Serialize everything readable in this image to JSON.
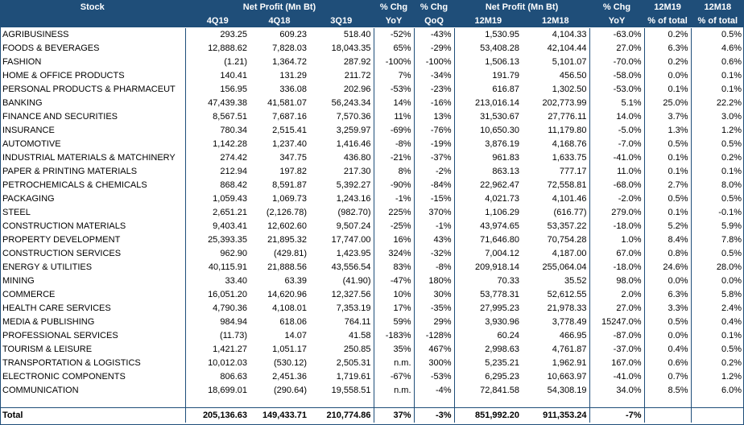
{
  "header": {
    "stock": "Stock",
    "net_profit_q": "Net Profit (Mn Bt)",
    "pct_chg_yoy_top": "% Chg",
    "pct_chg_qoq_top": "% Chg",
    "net_profit_12m": "Net Profit (Mn Bt)",
    "pct_chg_12m_top": "% Chg",
    "m19_top": "12M19",
    "m18_top": "12M18",
    "q4_19": "4Q19",
    "q4_18": "4Q18",
    "q3_19": "3Q19",
    "yoy": "YoY",
    "qoq": "QoQ",
    "m12_19": "12M19",
    "m12_18": "12M18",
    "yoy2": "YoY",
    "pct_total_19": "% of total",
    "pct_total_18": "% of total"
  },
  "rows": [
    {
      "name": "AGRIBUSINESS",
      "q4_19": "293.25",
      "q4_18": "609.23",
      "q3_19": "518.40",
      "yoy": "-52%",
      "qoq": "-43%",
      "m12_19": "1,530.95",
      "m12_18": "4,104.33",
      "chg12": "-63.0%",
      "pt19": "0.2%",
      "pt18": "0.5%"
    },
    {
      "name": "FOODS & BEVERAGES",
      "q4_19": "12,888.62",
      "q4_18": "7,828.03",
      "q3_19": "18,043.35",
      "yoy": "65%",
      "qoq": "-29%",
      "m12_19": "53,408.28",
      "m12_18": "42,104.44",
      "chg12": "27.0%",
      "pt19": "6.3%",
      "pt18": "4.6%"
    },
    {
      "name": "FASHION",
      "q4_19": "(1.21)",
      "q4_18": "1,364.72",
      "q3_19": "287.92",
      "yoy": "-100%",
      "qoq": "-100%",
      "m12_19": "1,506.13",
      "m12_18": "5,101.07",
      "chg12": "-70.0%",
      "pt19": "0.2%",
      "pt18": "0.6%"
    },
    {
      "name": "HOME & OFFICE PRODUCTS",
      "q4_19": "140.41",
      "q4_18": "131.29",
      "q3_19": "211.72",
      "yoy": "7%",
      "qoq": "-34%",
      "m12_19": "191.79",
      "m12_18": "456.50",
      "chg12": "-58.0%",
      "pt19": "0.0%",
      "pt18": "0.1%"
    },
    {
      "name": "PERSONAL PRODUCTS & PHARMACEUT",
      "q4_19": "156.95",
      "q4_18": "336.08",
      "q3_19": "202.96",
      "yoy": "-53%",
      "qoq": "-23%",
      "m12_19": "616.87",
      "m12_18": "1,302.50",
      "chg12": "-53.0%",
      "pt19": "0.1%",
      "pt18": "0.1%"
    },
    {
      "name": "BANKING",
      "q4_19": "47,439.38",
      "q4_18": "41,581.07",
      "q3_19": "56,243.34",
      "yoy": "14%",
      "qoq": "-16%",
      "m12_19": "213,016.14",
      "m12_18": "202,773.99",
      "chg12": "5.1%",
      "pt19": "25.0%",
      "pt18": "22.2%"
    },
    {
      "name": "FINANCE AND SECURITIES",
      "q4_19": "8,567.51",
      "q4_18": "7,687.16",
      "q3_19": "7,570.36",
      "yoy": "11%",
      "qoq": "13%",
      "m12_19": "31,530.67",
      "m12_18": "27,776.11",
      "chg12": "14.0%",
      "pt19": "3.7%",
      "pt18": "3.0%"
    },
    {
      "name": "INSURANCE",
      "q4_19": "780.34",
      "q4_18": "2,515.41",
      "q3_19": "3,259.97",
      "yoy": "-69%",
      "qoq": "-76%",
      "m12_19": "10,650.30",
      "m12_18": "11,179.80",
      "chg12": "-5.0%",
      "pt19": "1.3%",
      "pt18": "1.2%"
    },
    {
      "name": "AUTOMOTIVE",
      "q4_19": "1,142.28",
      "q4_18": "1,237.40",
      "q3_19": "1,416.46",
      "yoy": "-8%",
      "qoq": "-19%",
      "m12_19": "3,876.19",
      "m12_18": "4,168.76",
      "chg12": "-7.0%",
      "pt19": "0.5%",
      "pt18": "0.5%"
    },
    {
      "name": "INDUSTRIAL MATERIALS & MATCHINERY",
      "q4_19": "274.42",
      "q4_18": "347.75",
      "q3_19": "436.80",
      "yoy": "-21%",
      "qoq": "-37%",
      "m12_19": "961.83",
      "m12_18": "1,633.75",
      "chg12": "-41.0%",
      "pt19": "0.1%",
      "pt18": "0.2%"
    },
    {
      "name": "PAPER & PRINTING MATERIALS",
      "q4_19": "212.94",
      "q4_18": "197.82",
      "q3_19": "217.30",
      "yoy": "8%",
      "qoq": "-2%",
      "m12_19": "863.13",
      "m12_18": "777.17",
      "chg12": "11.0%",
      "pt19": "0.1%",
      "pt18": "0.1%"
    },
    {
      "name": "PETROCHEMICALS & CHEMICALS",
      "q4_19": "868.42",
      "q4_18": "8,591.87",
      "q3_19": "5,392.27",
      "yoy": "-90%",
      "qoq": "-84%",
      "m12_19": "22,962.47",
      "m12_18": "72,558.81",
      "chg12": "-68.0%",
      "pt19": "2.7%",
      "pt18": "8.0%"
    },
    {
      "name": "PACKAGING",
      "q4_19": "1,059.43",
      "q4_18": "1,069.73",
      "q3_19": "1,243.16",
      "yoy": "-1%",
      "qoq": "-15%",
      "m12_19": "4,021.73",
      "m12_18": "4,101.46",
      "chg12": "-2.0%",
      "pt19": "0.5%",
      "pt18": "0.5%"
    },
    {
      "name": "STEEL",
      "q4_19": "2,651.21",
      "q4_18": "(2,126.78)",
      "q3_19": "(982.70)",
      "yoy": "225%",
      "qoq": "370%",
      "m12_19": "1,106.29",
      "m12_18": "(616.77)",
      "chg12": "279.0%",
      "pt19": "0.1%",
      "pt18": "-0.1%"
    },
    {
      "name": "CONSTRUCTION MATERIALS",
      "q4_19": "9,403.41",
      "q4_18": "12,602.60",
      "q3_19": "9,507.24",
      "yoy": "-25%",
      "qoq": "-1%",
      "m12_19": "43,974.65",
      "m12_18": "53,357.22",
      "chg12": "-18.0%",
      "pt19": "5.2%",
      "pt18": "5.9%"
    },
    {
      "name": "PROPERTY DEVELOPMENT",
      "q4_19": "25,393.35",
      "q4_18": "21,895.32",
      "q3_19": "17,747.00",
      "yoy": "16%",
      "qoq": "43%",
      "m12_19": "71,646.80",
      "m12_18": "70,754.28",
      "chg12": "1.0%",
      "pt19": "8.4%",
      "pt18": "7.8%"
    },
    {
      "name": "CONSTRUCTION SERVICES",
      "q4_19": "962.90",
      "q4_18": "(429.81)",
      "q3_19": "1,423.95",
      "yoy": "324%",
      "qoq": "-32%",
      "m12_19": "7,004.12",
      "m12_18": "4,187.00",
      "chg12": "67.0%",
      "pt19": "0.8%",
      "pt18": "0.5%"
    },
    {
      "name": "ENERGY & UTILITIES",
      "q4_19": "40,115.91",
      "q4_18": "21,888.56",
      "q3_19": "43,556.54",
      "yoy": "83%",
      "qoq": "-8%",
      "m12_19": "209,918.14",
      "m12_18": "255,064.04",
      "chg12": "-18.0%",
      "pt19": "24.6%",
      "pt18": "28.0%"
    },
    {
      "name": "MINING",
      "q4_19": "33.40",
      "q4_18": "63.39",
      "q3_19": "(41.90)",
      "yoy": "-47%",
      "qoq": "180%",
      "m12_19": "70.33",
      "m12_18": "35.52",
      "chg12": "98.0%",
      "pt19": "0.0%",
      "pt18": "0.0%"
    },
    {
      "name": "COMMERCE",
      "q4_19": "16,051.20",
      "q4_18": "14,620.96",
      "q3_19": "12,327.56",
      "yoy": "10%",
      "qoq": "30%",
      "m12_19": "53,778.31",
      "m12_18": "52,612.55",
      "chg12": "2.0%",
      "pt19": "6.3%",
      "pt18": "5.8%"
    },
    {
      "name": "HEALTH CARE SERVICES",
      "q4_19": "4,790.36",
      "q4_18": "4,108.01",
      "q3_19": "7,353.19",
      "yoy": "17%",
      "qoq": "-35%",
      "m12_19": "27,995.23",
      "m12_18": "21,978.33",
      "chg12": "27.0%",
      "pt19": "3.3%",
      "pt18": "2.4%"
    },
    {
      "name": "MEDIA & PUBLISHING",
      "q4_19": "984.94",
      "q4_18": "618.06",
      "q3_19": "764.11",
      "yoy": "59%",
      "qoq": "29%",
      "m12_19": "3,930.96",
      "m12_18": "3,778.49",
      "chg12": "15247.0%",
      "pt19": "0.5%",
      "pt18": "0.4%"
    },
    {
      "name": "PROFESSIONAL SERVICES",
      "q4_19": "(11.73)",
      "q4_18": "14.07",
      "q3_19": "41.58",
      "yoy": "-183%",
      "qoq": "-128%",
      "m12_19": "60.24",
      "m12_18": "466.95",
      "chg12": "-87.0%",
      "pt19": "0.0%",
      "pt18": "0.1%"
    },
    {
      "name": "TOURISM & LEISURE",
      "q4_19": "1,421.27",
      "q4_18": "1,051.17",
      "q3_19": "250.85",
      "yoy": "35%",
      "qoq": "467%",
      "m12_19": "2,998.63",
      "m12_18": "4,761.87",
      "chg12": "-37.0%",
      "pt19": "0.4%",
      "pt18": "0.5%"
    },
    {
      "name": "TRANSPORTATION & LOGISTICS",
      "q4_19": "10,012.03",
      "q4_18": "(530.12)",
      "q3_19": "2,505.31",
      "yoy": "n.m.",
      "qoq": "300%",
      "m12_19": "5,235.21",
      "m12_18": "1,962.91",
      "chg12": "167.0%",
      "pt19": "0.6%",
      "pt18": "0.2%"
    },
    {
      "name": "ELECTRONIC COMPONENTS",
      "q4_19": "806.63",
      "q4_18": "2,451.36",
      "q3_19": "1,719.61",
      "yoy": "-67%",
      "qoq": "-53%",
      "m12_19": "6,295.23",
      "m12_18": "10,663.97",
      "chg12": "-41.0%",
      "pt19": "0.7%",
      "pt18": "1.2%"
    },
    {
      "name": "COMMUNICATION",
      "q4_19": "18,699.01",
      "q4_18": "(290.64)",
      "q3_19": "19,558.51",
      "yoy": "n.m.",
      "qoq": "-4%",
      "m12_19": "72,841.58",
      "m12_18": "54,308.19",
      "chg12": "34.0%",
      "pt19": "8.5%",
      "pt18": "6.0%"
    }
  ],
  "total": {
    "name": "Total",
    "q4_19": "205,136.63",
    "q4_18": "149,433.71",
    "q3_19": "210,774.86",
    "yoy": "37%",
    "qoq": "-3%",
    "m12_19": "851,992.20",
    "m12_18": "911,353.24",
    "chg12": "-7%",
    "pt19": "",
    "pt18": ""
  },
  "colors": {
    "header_bg": "#1f4e79",
    "header_text": "#ffffff",
    "border": "#1f4e79"
  }
}
